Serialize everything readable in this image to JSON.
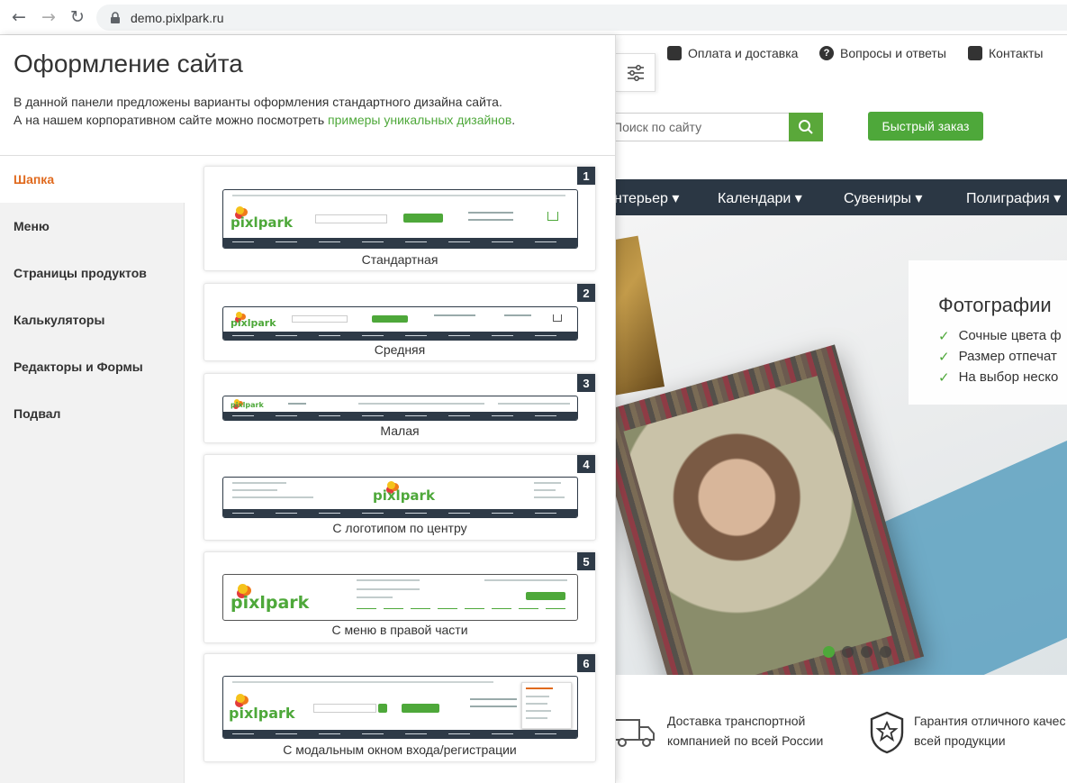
{
  "browser": {
    "url": "demo.pixlpark.ru"
  },
  "site": {
    "top_links": [
      "Оплата и доставка",
      "Вопросы и ответы",
      "Контакты"
    ],
    "search_placeholder": "Поиск по сайту",
    "quick_order": "Быстрый заказ",
    "nav": [
      "нтерьер",
      "Календари",
      "Сувениры",
      "Полиграфия"
    ],
    "promo": {
      "title": "Фотографии",
      "items": [
        "Сочные цвета ф",
        "Размер отпечат",
        "На выбор неско"
      ]
    },
    "slider": {
      "total": 4,
      "active": 1
    },
    "features": [
      {
        "line1": "Доставка транспортной",
        "line2": "компанией по всей России"
      },
      {
        "line1": "Гарантия отличного качес",
        "line2": "всей продукции"
      }
    ]
  },
  "panel": {
    "title": "Оформление сайта",
    "desc_line1": "В данной панели предложены варианты оформления стандартного дизайна сайта.",
    "desc_line2_prefix": "А на нашем корпоративном сайте можно посмотреть ",
    "desc_link": "примеры уникальных дизайнов",
    "desc_line2_suffix": ".",
    "sidebar": [
      {
        "label": "Шапка",
        "active": true
      },
      {
        "label": "Меню",
        "active": false
      },
      {
        "label": "Страницы продуктов",
        "active": false
      },
      {
        "label": "Калькуляторы",
        "active": false
      },
      {
        "label": "Редакторы и Формы",
        "active": false
      },
      {
        "label": "Подвал",
        "active": false
      }
    ],
    "variants": [
      {
        "num": "1",
        "label": "Стандартная"
      },
      {
        "num": "2",
        "label": "Средняя"
      },
      {
        "num": "3",
        "label": "Малая"
      },
      {
        "num": "4",
        "label": "С логотипом по центру"
      },
      {
        "num": "5",
        "label": "С меню в правой части"
      },
      {
        "num": "6",
        "label": "С модальным окном входа/регистрации"
      }
    ],
    "logo_text": "pixlpark"
  },
  "colors": {
    "accent_green": "#4ea83a",
    "active_orange": "#e06a1e",
    "nav_dark": "#2b3744"
  }
}
